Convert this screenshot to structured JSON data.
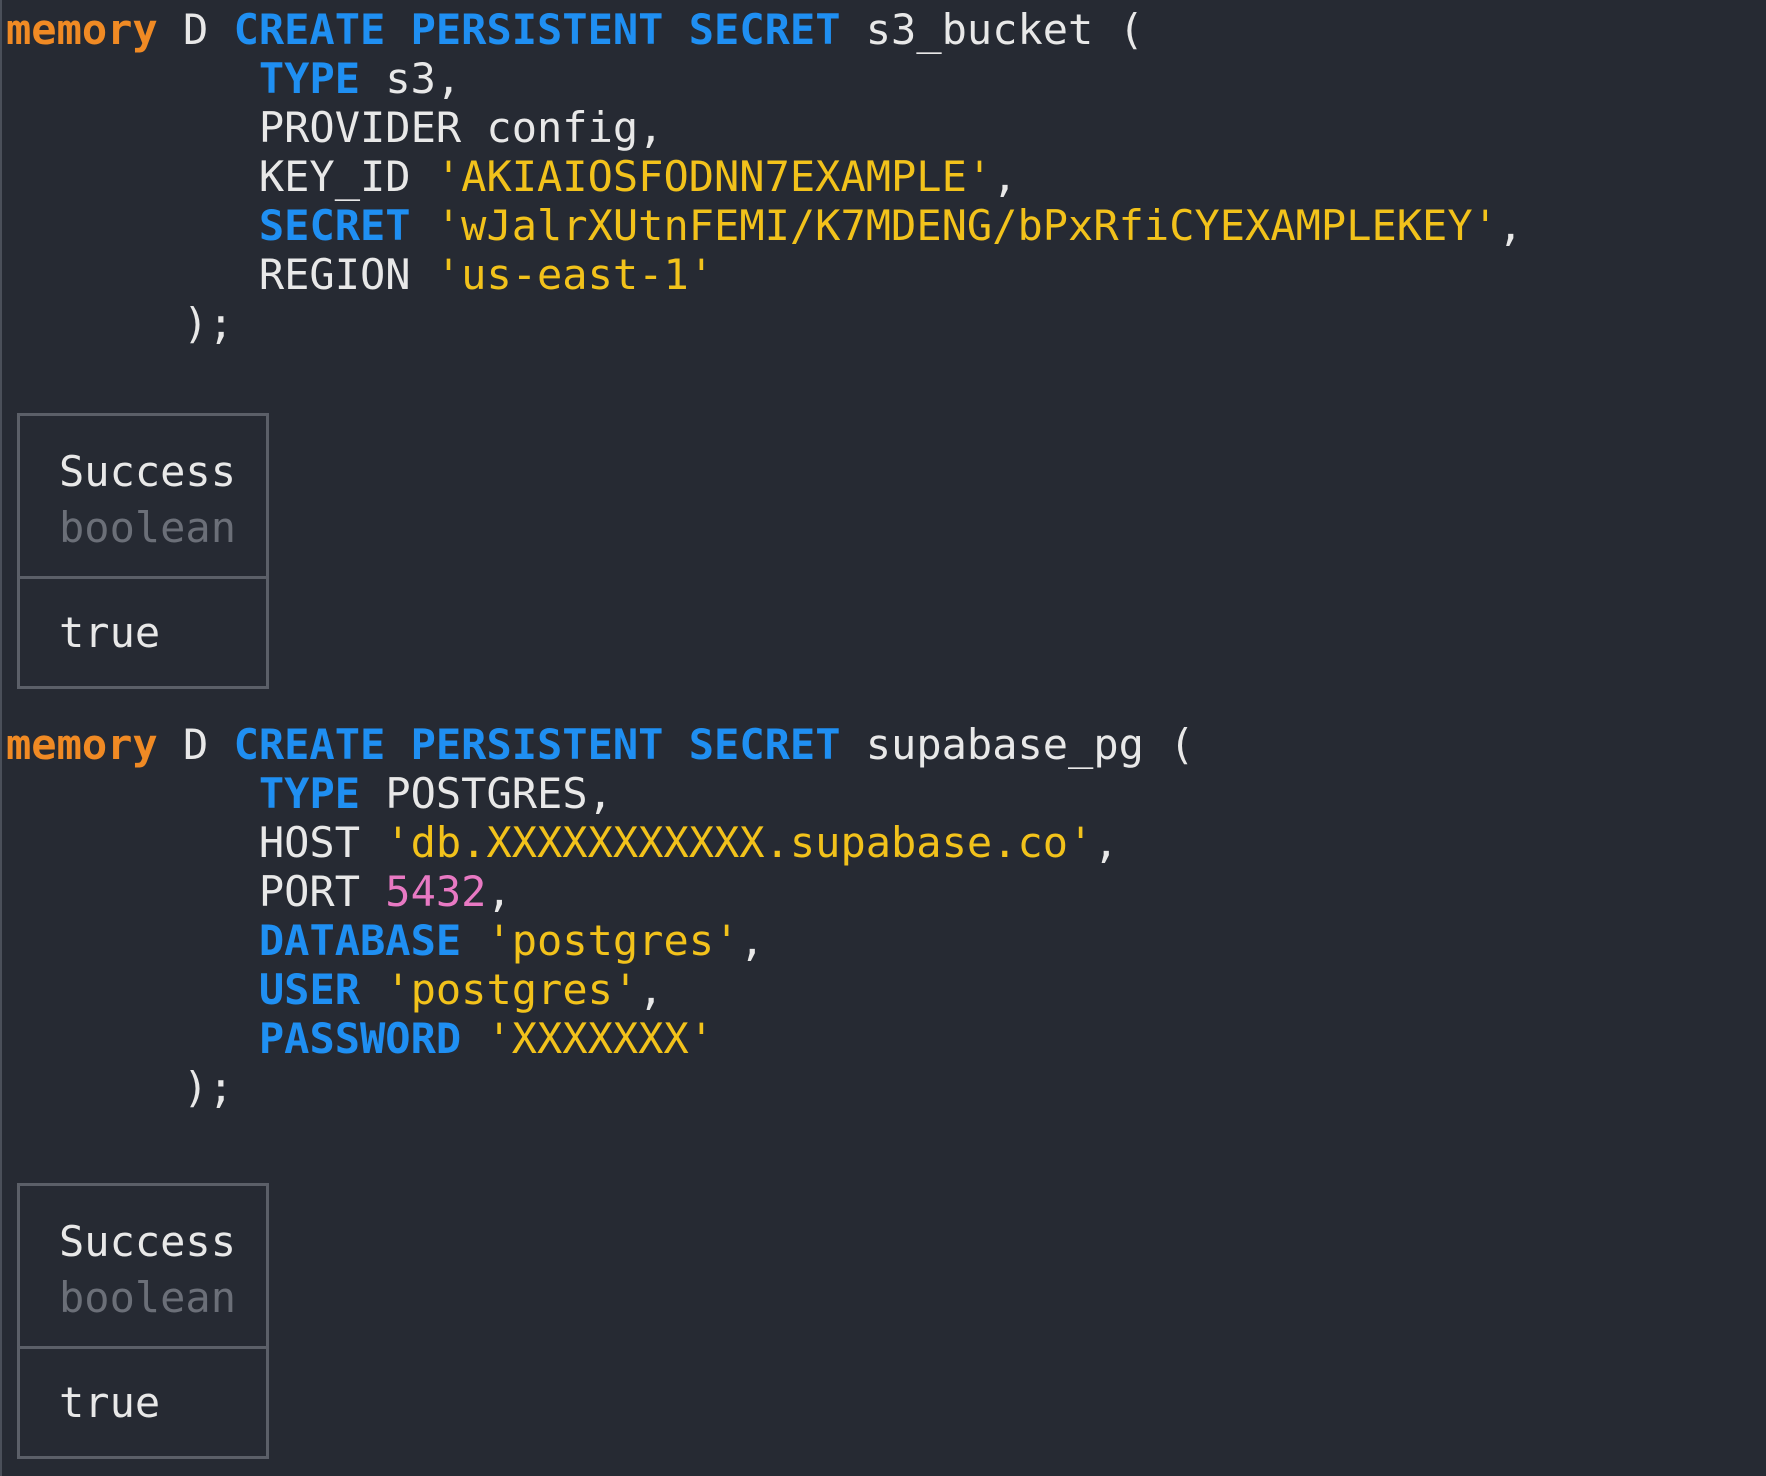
{
  "colors": {
    "prompt": "#f08a24",
    "keyword": "#1f8ff2",
    "plain": "#e8e8e8",
    "string": "#f2c21b",
    "number": "#e879c3",
    "muted": "#6b6f78",
    "background": "#262a33",
    "border": "#5b5f68"
  },
  "blocks": [
    {
      "lines": [
        [
          [
            "memory",
            "prompt"
          ],
          [
            " D ",
            "plain"
          ],
          [
            "CREATE",
            "keyword"
          ],
          [
            " ",
            "plain"
          ],
          [
            "PERSISTENT",
            "keyword"
          ],
          [
            " ",
            "plain"
          ],
          [
            "SECRET",
            "keyword"
          ],
          [
            " s3_bucket (",
            "plain"
          ]
        ],
        [
          [
            "          ",
            "plain"
          ],
          [
            "TYPE",
            "keyword"
          ],
          [
            " s3,",
            "plain"
          ]
        ],
        [
          [
            "          PROVIDER config,",
            "plain"
          ]
        ],
        [
          [
            "          KEY_ID ",
            "plain"
          ],
          [
            "'AKIAIOSFODNN7EXAMPLE'",
            "string"
          ],
          [
            ",",
            "plain"
          ]
        ],
        [
          [
            "          ",
            "plain"
          ],
          [
            "SECRET",
            "keyword"
          ],
          [
            " ",
            "plain"
          ],
          [
            "'wJalrXUtnFEMI/K7MDENG/bPxRfiCYEXAMPLEKEY'",
            "string"
          ],
          [
            ",",
            "plain"
          ]
        ],
        [
          [
            "          REGION ",
            "plain"
          ],
          [
            "'us-east-1'",
            "string"
          ]
        ],
        [
          [
            "       );",
            "plain"
          ]
        ]
      ],
      "result": {
        "column": "Success",
        "type": "boolean",
        "value": "true"
      }
    },
    {
      "lines": [
        [
          [
            "memory",
            "prompt"
          ],
          [
            " D ",
            "plain"
          ],
          [
            "CREATE",
            "keyword"
          ],
          [
            " ",
            "plain"
          ],
          [
            "PERSISTENT",
            "keyword"
          ],
          [
            " ",
            "plain"
          ],
          [
            "SECRET",
            "keyword"
          ],
          [
            " supabase_pg (",
            "plain"
          ]
        ],
        [
          [
            "          ",
            "plain"
          ],
          [
            "TYPE",
            "keyword"
          ],
          [
            " POSTGRES,",
            "plain"
          ]
        ],
        [
          [
            "          HOST ",
            "plain"
          ],
          [
            "'db.XXXXXXXXXXX.supabase.co'",
            "string"
          ],
          [
            ",",
            "plain"
          ]
        ],
        [
          [
            "          PORT ",
            "plain"
          ],
          [
            "5432",
            "number"
          ],
          [
            ",",
            "plain"
          ]
        ],
        [
          [
            "          ",
            "plain"
          ],
          [
            "DATABASE",
            "keyword"
          ],
          [
            " ",
            "plain"
          ],
          [
            "'postgres'",
            "string"
          ],
          [
            ",",
            "plain"
          ]
        ],
        [
          [
            "          ",
            "plain"
          ],
          [
            "USER",
            "keyword"
          ],
          [
            " ",
            "plain"
          ],
          [
            "'postgres'",
            "string"
          ],
          [
            ",",
            "plain"
          ]
        ],
        [
          [
            "          ",
            "plain"
          ],
          [
            "PASSWORD",
            "keyword"
          ],
          [
            " ",
            "plain"
          ],
          [
            "'XXXXXXX'",
            "string"
          ]
        ],
        [
          [
            "       );",
            "plain"
          ]
        ]
      ],
      "result": {
        "column": "Success",
        "type": "boolean",
        "value": "true"
      }
    }
  ]
}
